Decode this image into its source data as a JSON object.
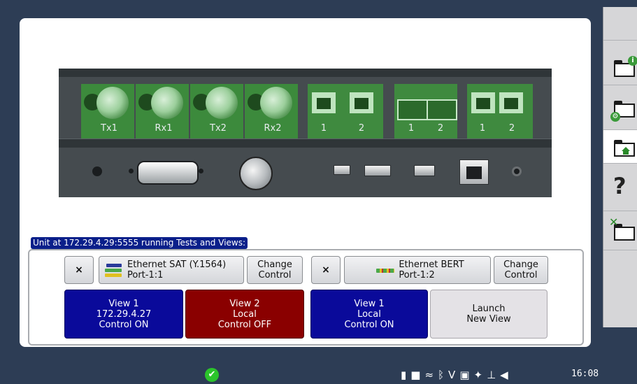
{
  "hardware": {
    "optical_ports": [
      "Tx1",
      "Rx1",
      "Tx2",
      "Rx2"
    ],
    "rj45_group_1": [
      "1",
      "2"
    ],
    "sfp_group": [
      "1",
      "2"
    ],
    "rj45_group_2": [
      "1",
      "2"
    ]
  },
  "unit_status": "Unit at 172.29.4.29:5555 running Tests and Views:",
  "groups": [
    {
      "close_label": "×",
      "test_name": "Ethernet SAT (Y.1564)",
      "test_port": "Port-1:1",
      "change_line1": "Change",
      "change_line2": "Control",
      "views": [
        {
          "line1": "View 1",
          "line2": "172.29.4.27",
          "line3": "Control ON",
          "color": "#0a0a9a"
        },
        {
          "line1": "View 2",
          "line2": "Local",
          "line3": "Control OFF",
          "color": "#8a0000"
        }
      ]
    },
    {
      "close_label": "×",
      "test_name": "Ethernet BERT",
      "test_port": "Port-1:2",
      "change_line1": "Change",
      "change_line2": "Control",
      "views": [
        {
          "line1": "View 1",
          "line2": "Local",
          "line3": "Control ON",
          "color": "#0a0a9a"
        }
      ],
      "launch_line1": "Launch",
      "launch_line2": "New View"
    }
  ],
  "sidebar": {
    "items": [
      {
        "icon": "folder-info-icon"
      },
      {
        "icon": "folder-settings-icon"
      },
      {
        "icon": "folder-home-icon"
      },
      {
        "icon": "help-icon",
        "glyph": "?"
      },
      {
        "icon": "folder-tools-icon"
      }
    ]
  },
  "statusbar": {
    "ok_icon": "checkmark-icon",
    "ok_glyph": "✔",
    "time": "16:08",
    "tray_icons": [
      "battery-plug-icon",
      "storage-icon",
      "wifi-off-icon",
      "bluetooth-off-icon",
      "v-icon",
      "screen-off-icon",
      "satellite-off-icon",
      "network-icon",
      "volume-icon"
    ]
  },
  "colors": {
    "background": "#2d3d55",
    "view_on": "#0a0a9a",
    "view_off": "#8a0000",
    "port_green": "#3c8a3c",
    "status_ok": "#2bc42b"
  }
}
